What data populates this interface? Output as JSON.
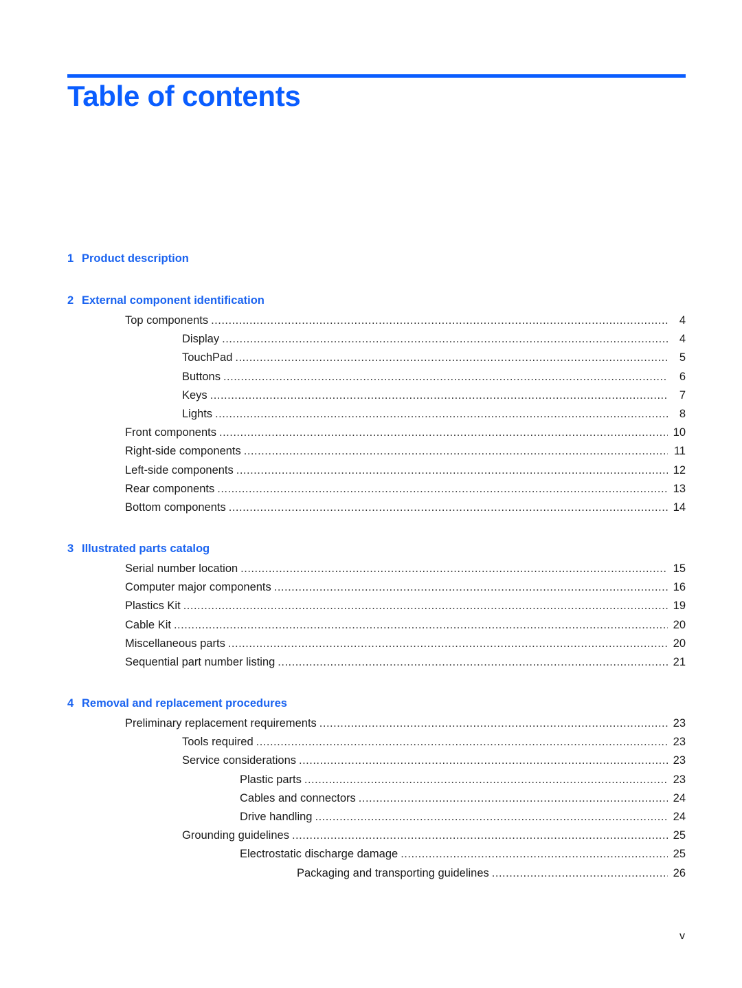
{
  "page_title": "Table of contents",
  "folio": "v",
  "accent_color": "#0a5dff",
  "chapters": [
    {
      "num": "1",
      "title": "Product description",
      "entries": []
    },
    {
      "num": "2",
      "title": "External component identification",
      "entries": [
        {
          "level": 1,
          "label": "Top components",
          "page": "4"
        },
        {
          "level": 2,
          "label": "Display",
          "page": "4"
        },
        {
          "level": 2,
          "label": "TouchPad",
          "page": "5"
        },
        {
          "level": 2,
          "label": "Buttons",
          "page": "6"
        },
        {
          "level": 2,
          "label": "Keys",
          "page": "7"
        },
        {
          "level": 2,
          "label": "Lights",
          "page": "8"
        },
        {
          "level": 1,
          "label": "Front components",
          "page": "10"
        },
        {
          "level": 1,
          "label": "Right-side components",
          "page": "11"
        },
        {
          "level": 1,
          "label": "Left-side components",
          "page": "12"
        },
        {
          "level": 1,
          "label": "Rear components",
          "page": "13"
        },
        {
          "level": 1,
          "label": "Bottom components",
          "page": "14"
        }
      ]
    },
    {
      "num": "3",
      "title": "Illustrated parts catalog",
      "entries": [
        {
          "level": 1,
          "label": "Serial number location",
          "page": "15"
        },
        {
          "level": 1,
          "label": "Computer major components",
          "page": "16"
        },
        {
          "level": 1,
          "label": "Plastics Kit",
          "page": "19"
        },
        {
          "level": 1,
          "label": "Cable Kit",
          "page": "20"
        },
        {
          "level": 1,
          "label": "Miscellaneous parts",
          "page": "20"
        },
        {
          "level": 1,
          "label": "Sequential part number listing",
          "page": "21"
        }
      ]
    },
    {
      "num": "4",
      "title": "Removal and replacement procedures",
      "entries": [
        {
          "level": 1,
          "label": "Preliminary replacement requirements",
          "page": "23"
        },
        {
          "level": 2,
          "label": "Tools required",
          "page": "23"
        },
        {
          "level": 2,
          "label": "Service considerations",
          "page": "23"
        },
        {
          "level": 3,
          "label": "Plastic parts",
          "page": "23"
        },
        {
          "level": 3,
          "label": "Cables and connectors",
          "page": "24"
        },
        {
          "level": 3,
          "label": "Drive handling",
          "page": "24"
        },
        {
          "level": 2,
          "label": "Grounding guidelines",
          "page": "25"
        },
        {
          "level": 3,
          "label": "Electrostatic discharge damage",
          "page": "25"
        },
        {
          "level": 4,
          "label": "Packaging and transporting guidelines",
          "page": "26"
        }
      ]
    }
  ]
}
